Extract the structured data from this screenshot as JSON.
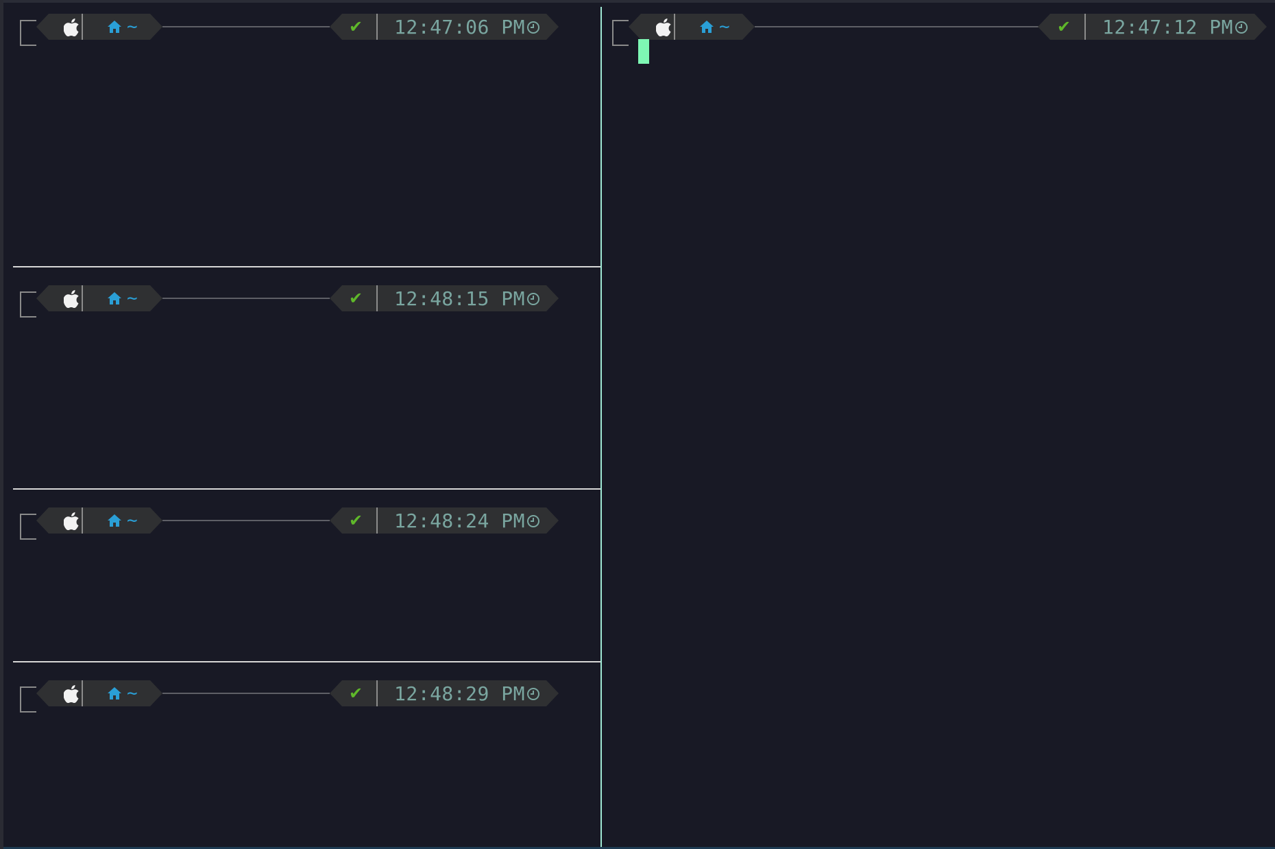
{
  "panes": [
    {
      "id": "left-1",
      "time": "12:47:06 PM",
      "status": "✔",
      "path": "~"
    },
    {
      "id": "left-2",
      "time": "12:48:15 PM",
      "status": "✔",
      "path": "~"
    },
    {
      "id": "left-3",
      "time": "12:48:24 PM",
      "status": "✔",
      "path": "~"
    },
    {
      "id": "left-4",
      "time": "12:48:29 PM",
      "status": "✔",
      "path": "~"
    },
    {
      "id": "right-1",
      "time": "12:47:12 PM",
      "status": "✔",
      "path": "~"
    }
  ],
  "icons": {
    "os": "apple-icon",
    "dir": "home-icon",
    "clock": "clock-icon"
  },
  "colors": {
    "background": "#181925",
    "segment": "#2f3032",
    "path": "#2a9fd6",
    "ok": "#5fb82a",
    "time": "#7aa6a0",
    "cursor": "#7ef7b4",
    "active_divider": "#9fe8d4"
  }
}
